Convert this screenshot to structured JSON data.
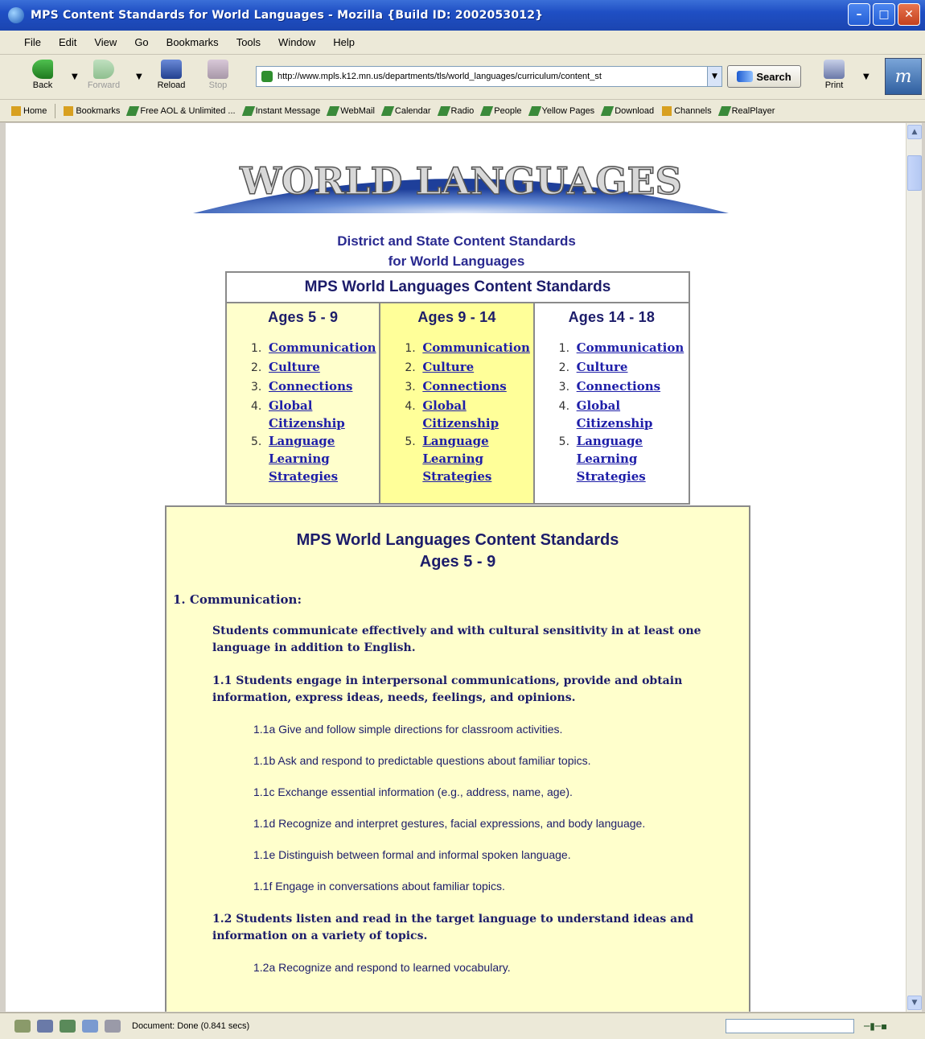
{
  "window": {
    "title": "MPS Content Standards for World Languages - Mozilla {Build ID: 2002053012}"
  },
  "menu": [
    "File",
    "Edit",
    "View",
    "Go",
    "Bookmarks",
    "Tools",
    "Window",
    "Help"
  ],
  "nav": {
    "back": "Back",
    "forward": "Forward",
    "reload": "Reload",
    "stop": "Stop",
    "url": "http://www.mpls.k12.mn.us/departments/tls/world_languages/curriculum/content_st",
    "search": "Search",
    "print": "Print"
  },
  "personal_toolbar": [
    "Home",
    "Bookmarks",
    "Free AOL & Unlimited ...",
    "Instant Message",
    "WebMail",
    "Calendar",
    "Radio",
    "People",
    "Yellow Pages",
    "Download",
    "Channels",
    "RealPlayer"
  ],
  "page": {
    "banner_text": "WORLD LANGUAGES",
    "subtitle_line1": "District and State Content Standards",
    "subtitle_line2": "for World Languages",
    "table_title": "MPS World Languages Content Standards",
    "columns": [
      {
        "age": "Ages 5 - 9",
        "items": [
          {
            "num": "1.",
            "label": "Communication"
          },
          {
            "num": "2.",
            "label": "Culture"
          },
          {
            "num": "3.",
            "label": "Connections"
          },
          {
            "num": "4.",
            "label": "Global Citizenship"
          },
          {
            "num": "5.",
            "label": "Language Learning Strategies"
          }
        ]
      },
      {
        "age": "Ages 9 - 14",
        "items": [
          {
            "num": "1.",
            "label": "Communication"
          },
          {
            "num": "2.",
            "label": "Culture"
          },
          {
            "num": "3.",
            "label": "Connections"
          },
          {
            "num": "4.",
            "label": "Global Citizenship"
          },
          {
            "num": "5.",
            "label": "Language Learning Strategies"
          }
        ]
      },
      {
        "age": "Ages 14 - 18",
        "items": [
          {
            "num": "1.",
            "label": "Communication"
          },
          {
            "num": "2.",
            "label": "Culture"
          },
          {
            "num": "3.",
            "label": "Connections"
          },
          {
            "num": "4.",
            "label": "Global Citizenship"
          },
          {
            "num": "5.",
            "label": "Language Learning Strategies"
          }
        ]
      }
    ],
    "box_title_line1": "MPS World Languages Content Standards",
    "box_title_line2": "Ages 5 - 9",
    "section_head": "1. Communication:",
    "standard_main": "Students communicate effectively and with cultural sensitivity in at least one language in addition to English.",
    "std_1_1": "1.1 Students engage in interpersonal communications, provide and obtain information, express ideas, needs, feelings, and opinions.",
    "benchmarks_1_1": [
      "1.1a Give and follow simple directions for classroom activities.",
      "1.1b Ask and respond to predictable questions about familiar topics.",
      "1.1c Exchange essential information (e.g., address, name, age).",
      "1.1d Recognize and interpret gestures, facial expressions, and body language.",
      "1.1e Distinguish between formal and informal spoken language.",
      "1.1f Engage in conversations about familiar topics."
    ],
    "std_1_2": "1.2 Students listen and read in the target language to understand ideas and information on a variety of topics.",
    "benchmarks_1_2": [
      "1.2a Recognize and respond to learned vocabulary."
    ]
  },
  "status": {
    "text": "Document: Done (0.841 secs)"
  },
  "colors": {
    "titlebar": "#1f4fc4",
    "link": "#1e1ea8",
    "heading": "#1c1c6a",
    "panel_light_yellow": "#ffffcc",
    "panel_yellow": "#ffff99"
  }
}
